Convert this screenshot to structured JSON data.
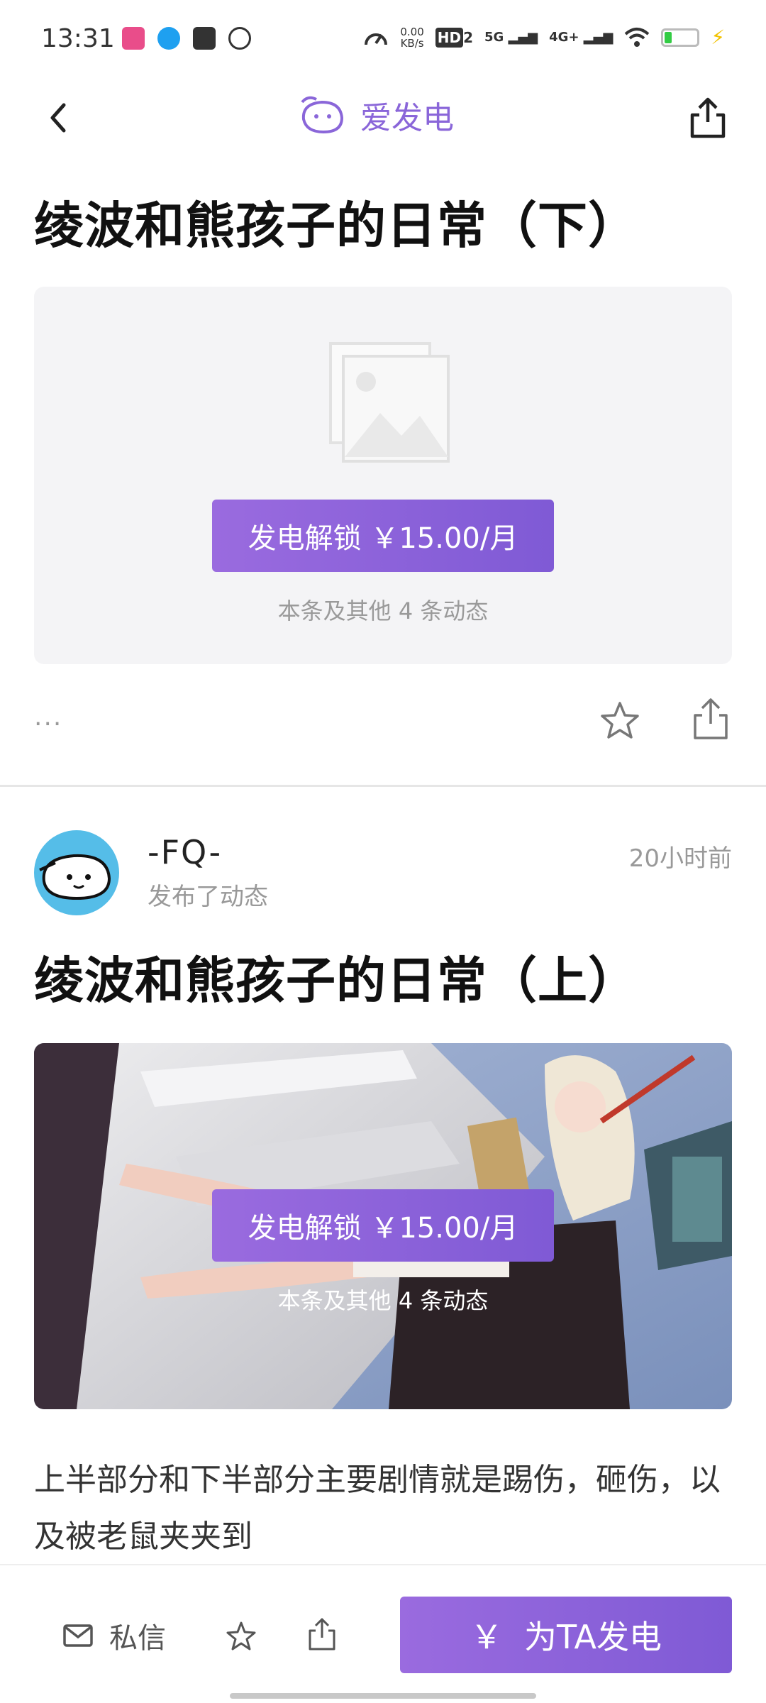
{
  "status_bar": {
    "time": "13:31",
    "net_speed_value": "0.00",
    "net_speed_unit": "KB/s",
    "hd": "HD",
    "hd_sub": "2",
    "sig_5g": "5G",
    "sig_4g": "4G+"
  },
  "header": {
    "brand": "爱发电",
    "brand_color": "#8a66d9"
  },
  "posts": [
    {
      "title": "绫波和熊孩子的日常（下）",
      "unlock_label": "发电解锁 ￥15.00/月",
      "unlock_note": "本条及其他 4 条动态",
      "more": "···"
    },
    {
      "author": "-FQ-",
      "action": "发布了动态",
      "time": "20小时前",
      "title": "绫波和熊孩子的日常（上）",
      "unlock_label": "发电解锁 ￥15.00/月",
      "unlock_note": "本条及其他 4 条动态",
      "description": "上半部分和下半部分主要剧情就是踢伤，砸伤，以及被老鼠夹夹到"
    }
  ],
  "bottom_bar": {
    "message_label": "私信",
    "charge_icon": "￥",
    "charge_label": "为TA发电"
  },
  "colors": {
    "accent": "#8a66d9",
    "button_gradient_start": "#9a6bdf",
    "button_gradient_end": "#7f5ad5",
    "avatar_bg": "#55bde8"
  }
}
